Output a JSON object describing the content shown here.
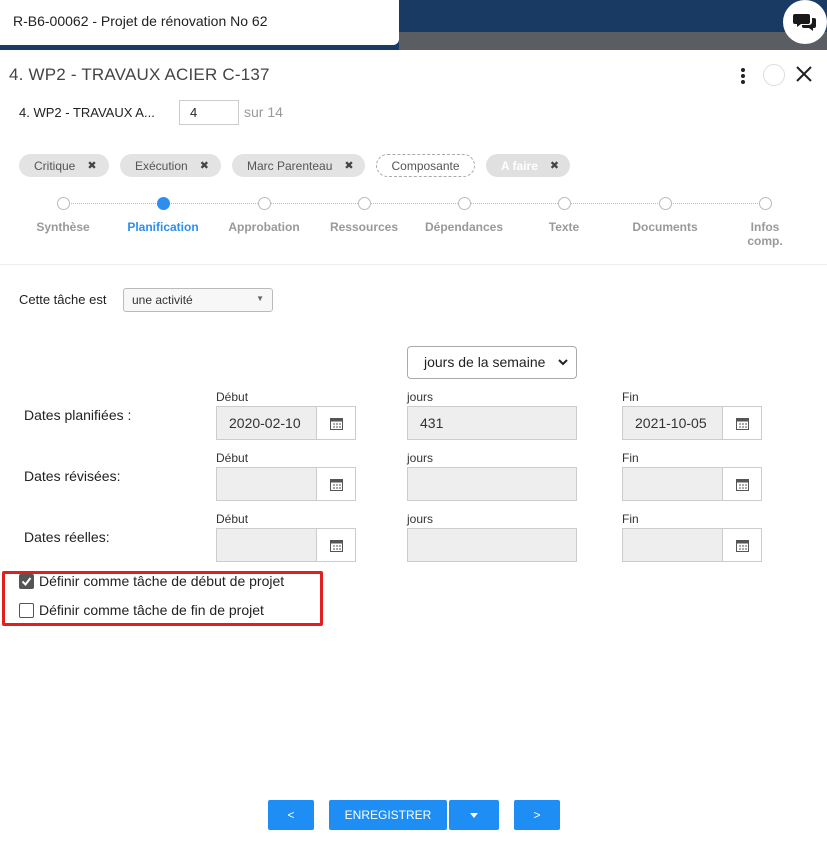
{
  "header": {
    "breadcrumb": "R-B6-00062 - Projet de rénovation No 62"
  },
  "dialog": {
    "title": "4. WP2 - TRAVAUX ACIER C-137",
    "subtitle": "4. WP2 - TRAVAUX A...",
    "page_value": "4",
    "page_total": "sur 14"
  },
  "tags": [
    {
      "label": "Critique"
    },
    {
      "label": "Exécution"
    },
    {
      "label": "Marc Parenteau"
    },
    {
      "label": "Composante"
    },
    {
      "label": "A faire"
    }
  ],
  "steps": [
    {
      "label": "Synthèse",
      "active": false
    },
    {
      "label": "Planification",
      "active": true
    },
    {
      "label": "Approbation",
      "active": false
    },
    {
      "label": "Ressources",
      "active": false
    },
    {
      "label": "Dépendances",
      "active": false
    },
    {
      "label": "Texte",
      "active": false
    },
    {
      "label": "Documents",
      "active": false
    },
    {
      "label": "Infos comp.",
      "active": false
    }
  ],
  "task": {
    "label": "Cette tâche est",
    "type_value": "une activité"
  },
  "mode_select": "jours de la semaine",
  "col_labels": {
    "start": "Début",
    "days": "jours",
    "end": "Fin"
  },
  "dates": {
    "planned": {
      "label": "Dates planifiées :",
      "start": "2020-02-10",
      "days": "431",
      "end": "2021-10-05"
    },
    "revised": {
      "label": "Dates révisées:",
      "start": "",
      "days": "",
      "end": ""
    },
    "actual": {
      "label": "Dates réelles:",
      "start": "",
      "days": "",
      "end": ""
    }
  },
  "checkboxes": {
    "project_start": {
      "label": "Définir comme tâche de début de projet",
      "checked": true
    },
    "project_end": {
      "label": "Définir comme tâche de fin de projet",
      "checked": false
    }
  },
  "footer": {
    "prev": "<",
    "save": "ENREGISTRER",
    "next": ">"
  },
  "colors": {
    "accent": "#1e8ef5",
    "header": "#183a63",
    "highlight": "#e02020"
  }
}
